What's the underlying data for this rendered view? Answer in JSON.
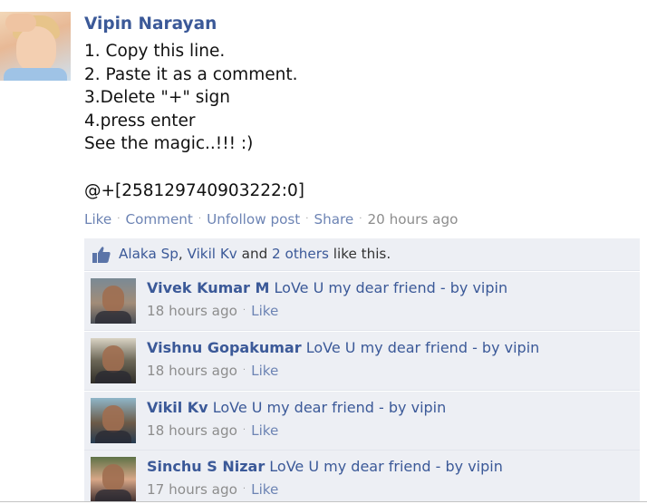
{
  "post": {
    "author": "Vipin Narayan",
    "lines": [
      "1. Copy this line.",
      "2. Paste it as a comment.",
      "3.Delete \"+\" sign",
      "4.press enter",
      "See the magic..!!! :)",
      "",
      "@+[258129740903222:0]"
    ],
    "actions": {
      "like": "Like",
      "comment": "Comment",
      "unfollow": "Unfollow post",
      "share": "Share",
      "separator": "·",
      "timestamp": "20 hours ago"
    }
  },
  "likes": {
    "icon": "thumbs-up-icon",
    "user1": "Alaka Sp",
    "comma": ", ",
    "user2": "Vikil Kv",
    "and": " and ",
    "others": "2 others",
    "suffix": " like this."
  },
  "comments": [
    {
      "name": "Vivek Kumar M",
      "text": "LoVe U my dear friend - by vipin",
      "time": "18 hours ago",
      "like": "Like",
      "separator": "·"
    },
    {
      "name": "Vishnu Gopakumar",
      "text": "LoVe U my dear friend - by vipin",
      "time": "18 hours ago",
      "like": "Like",
      "separator": "·"
    },
    {
      "name": "Vikil Kv",
      "text": "LoVe U my dear friend - by vipin",
      "time": "18 hours ago",
      "like": "Like",
      "separator": "·"
    },
    {
      "name": "Sinchu S Nizar",
      "text": "LoVe U my dear friend - by vipin",
      "time": "17 hours ago",
      "like": "Like",
      "separator": "·"
    }
  ],
  "colors": {
    "link": "#3b5998",
    "action_link": "#6d84b4",
    "meta_gray": "#8d8d8d",
    "panel_bg": "#edeff4"
  }
}
